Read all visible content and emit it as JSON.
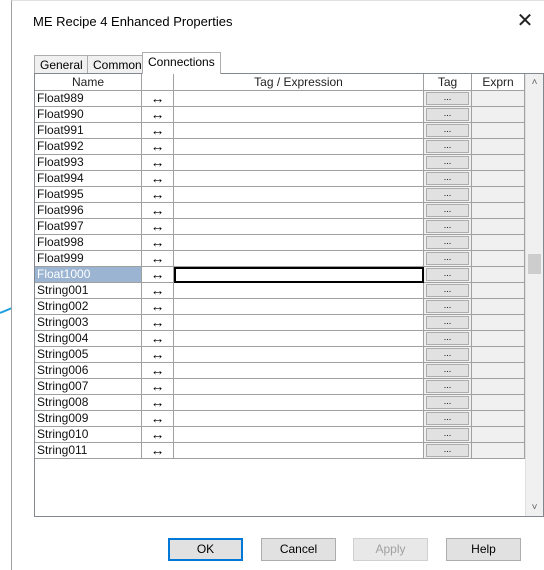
{
  "window": {
    "title": "ME Recipe 4 Enhanced Properties",
    "close_glyph": "✕"
  },
  "tabs": [
    {
      "label": "General",
      "active": false
    },
    {
      "label": "Common",
      "active": false
    },
    {
      "label": "Connections",
      "active": true
    }
  ],
  "grid": {
    "columns": {
      "name": "Name",
      "arrow": "",
      "tag_expression": "Tag / Expression",
      "tag": "Tag",
      "exprn": "Exprn"
    },
    "arrow_glyph": "↔",
    "tag_button_label": "...",
    "selected_row": "Float1000",
    "rows": [
      "Float989",
      "Float990",
      "Float991",
      "Float992",
      "Float993",
      "Float994",
      "Float995",
      "Float996",
      "Float997",
      "Float998",
      "Float999",
      "Float1000",
      "String001",
      "String002",
      "String003",
      "String004",
      "String005",
      "String006",
      "String007",
      "String008",
      "String009",
      "String010",
      "String011"
    ]
  },
  "buttons": {
    "ok": "OK",
    "cancel": "Cancel",
    "apply": "Apply",
    "help": "Help"
  },
  "colors": {
    "selection": "#9ab4d2",
    "callout": "#1ea0e0",
    "default_button_border": "#0078d7"
  }
}
